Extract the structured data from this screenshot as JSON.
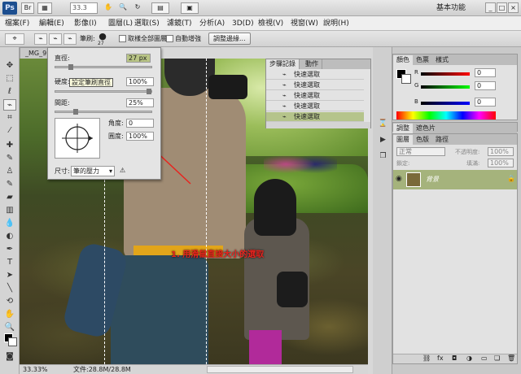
{
  "app": {
    "logo": "Ps",
    "zoom": "33.3",
    "workspace": "基本功能",
    "window_controls": [
      "_",
      "□",
      "×"
    ]
  },
  "menu": [
    "檔案(F)",
    "編輯(E)",
    "影像(I)",
    "圖層(L)",
    "選取(S)",
    "濾鏡(T)",
    "分析(A)",
    "3D(D)",
    "檢視(V)",
    "視窗(W)",
    "說明(H)"
  ],
  "options": {
    "brush_label": "筆刷:",
    "brush_size": "27",
    "sample_all_layers": "取樣全部圖層",
    "auto_enhance": "自動增強",
    "refine_edge": "調整邊緣..."
  },
  "document": {
    "tab": "_MG_9",
    "zoom_status": "33.33%",
    "file_status": "文件:28.8M/28.8M",
    "annotation": "1. 用滑鼠直接大小的選取"
  },
  "brush_popup": {
    "diameter_label": "直徑:",
    "diameter_value": "27 px",
    "tooltip": "設定筆刷直徑",
    "hardness_label": "硬度:",
    "hardness_value": "100%",
    "spacing_label": "間距:",
    "spacing_value": "25%",
    "angle_label": "角度:",
    "angle_value": "0",
    "roundness_label": "圓度:",
    "roundness_value": "100%",
    "size_label": "尺寸:",
    "size_value": "筆的壓力"
  },
  "history": {
    "tabs": [
      "步驟記錄",
      "動作"
    ],
    "rows": [
      "快速選取",
      "快速選取",
      "快速選取",
      "快速選取",
      "快速選取"
    ]
  },
  "color_panel": {
    "tabs": [
      "顏色",
      "色票",
      "樣式"
    ],
    "r_label": "R",
    "r_value": "0",
    "g_label": "G",
    "g_value": "0",
    "b_label": "B",
    "b_value": "0"
  },
  "adjust_panel": {
    "tabs": [
      "調整",
      "遮色片"
    ]
  },
  "layers_panel": {
    "tabs": [
      "圖層",
      "色版",
      "路徑"
    ],
    "blend_mode": "正常",
    "opacity_label": "不透明度:",
    "opacity_value": "100%",
    "lock_label": "鎖定:",
    "fill_label": "填滿:",
    "fill_value": "100%",
    "layer_name": "背景"
  },
  "colors": {
    "selection_highlight": "#b5c48b",
    "annotation": "#e8231e"
  }
}
